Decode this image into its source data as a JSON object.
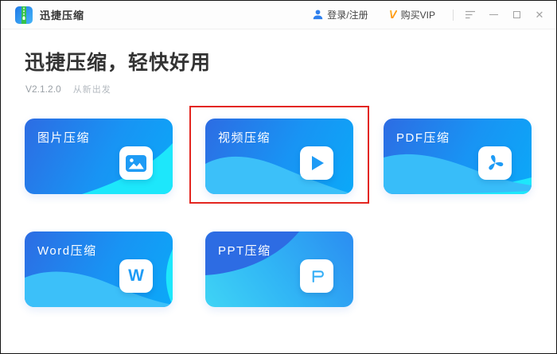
{
  "titlebar": {
    "app_title": "迅捷压缩",
    "login_label": "登录/注册",
    "vip_v": "V",
    "vip_label": "购买VIP",
    "close_glyph": "✕"
  },
  "hero": {
    "title": "迅捷压缩，轻快好用",
    "version": "V2.1.2.0",
    "slogan": "从新出发"
  },
  "cards": [
    {
      "id": "image",
      "label": "图片压缩",
      "icon": "image-icon"
    },
    {
      "id": "video",
      "label": "视频压缩",
      "icon": "play-icon",
      "highlighted": true
    },
    {
      "id": "pdf",
      "label": "PDF压缩",
      "icon": "pdf-icon"
    },
    {
      "id": "word",
      "label": "Word压缩",
      "icon": "letter-w-icon",
      "icon_letter": "W"
    },
    {
      "id": "ppt",
      "label": "PPT压缩",
      "icon": "letter-p-icon"
    }
  ],
  "annotation": {
    "type": "highlight-rectangle",
    "target": "视频压缩",
    "color": "#e3261f"
  },
  "colors": {
    "card_blue_dark": "#2d6ce3",
    "card_blue_light": "#0ba9f8",
    "wave_cyan": "#1de7fb",
    "wave_light_blue": "#3cc0f9",
    "accent_blue": "#2f80ed",
    "vip_orange": "#ff9800",
    "annotation_red": "#e3261f"
  }
}
